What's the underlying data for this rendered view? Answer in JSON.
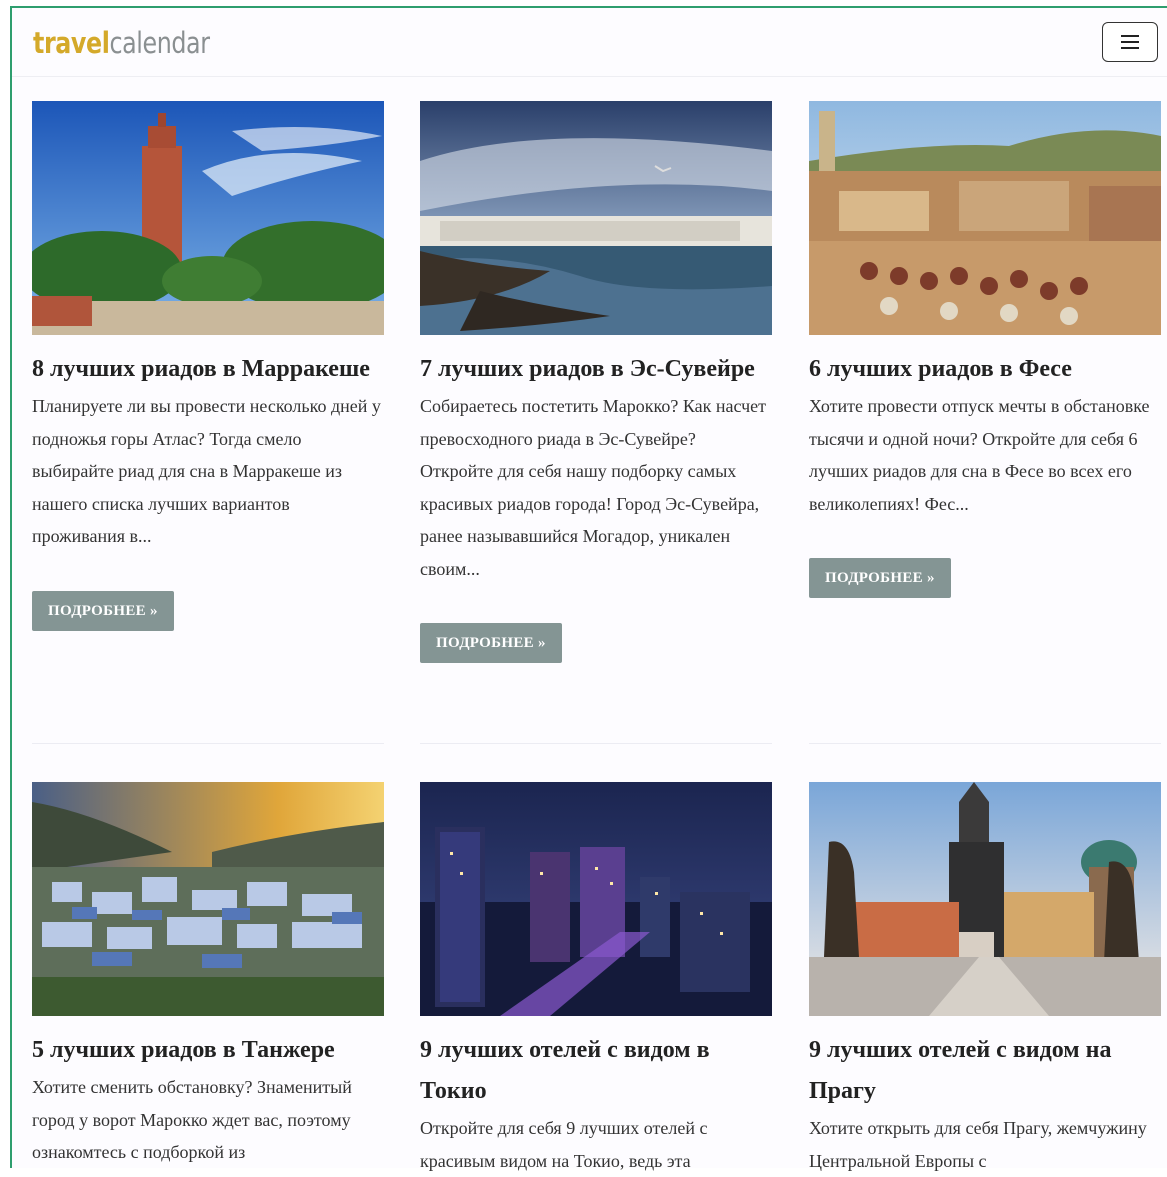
{
  "header": {
    "logo_part1": "travel",
    "logo_part2": "calendar",
    "menu_icon": "hamburger-icon"
  },
  "cards": [
    {
      "title": "8 лучших риадов в Марракеше",
      "excerpt": "Планируете ли вы провести несколько дней у подножья горы Атлас? Тогда смело выбирайте риад для сна в Марракеше из нашего списка лучших вариантов проживания в...",
      "button": "ПОДРОБНЕЕ »",
      "image": "marrakesh-koutoubia-photo"
    },
    {
      "title": "7 лучших риадов в Эс-Сувейре",
      "excerpt": "Собираетесь постетить Марокко? Как насчет превосходного риада в Эс-Сувейре? Откройте для себя нашу подборку самых красивых риадов города! Город Эс-Сувейра, ранее называвшийся Могадор, уникален своим...",
      "button": "ПОДРОБНЕЕ »",
      "image": "essaouira-coast-photo"
    },
    {
      "title": "6 лучших риадов в Фесе",
      "excerpt": "Хотите провести отпуск мечты в обстановке тысячи и одной ночи? Откройте для себя 6 лучших риадов для сна в Фесе во всех его великолепиях! Фес...",
      "button": "ПОДРОБНЕЕ »",
      "image": "fes-tannery-photo"
    },
    {
      "title": "5 лучших риадов в Танжере",
      "excerpt": "Хотите сменить обстановку? Знаменитый город у ворот Марокко ждет вас, поэтому ознакомтесь с подборкой из",
      "button": "",
      "image": "chefchaouen-blue-town-photo"
    },
    {
      "title": "9 лучших отелей с видом в Токио",
      "excerpt": "Откройте для себя 9 лучших отелей с красивым видом на Токио, ведь эта",
      "button": "",
      "image": "tokyo-night-skyline-photo"
    },
    {
      "title": "9 лучших отелей с видом на Прагу",
      "excerpt": "Хотите открыть для себя Прагу, жемчужину Центральной Европы с",
      "button": "",
      "image": "prague-charles-bridge-photo"
    }
  ]
}
